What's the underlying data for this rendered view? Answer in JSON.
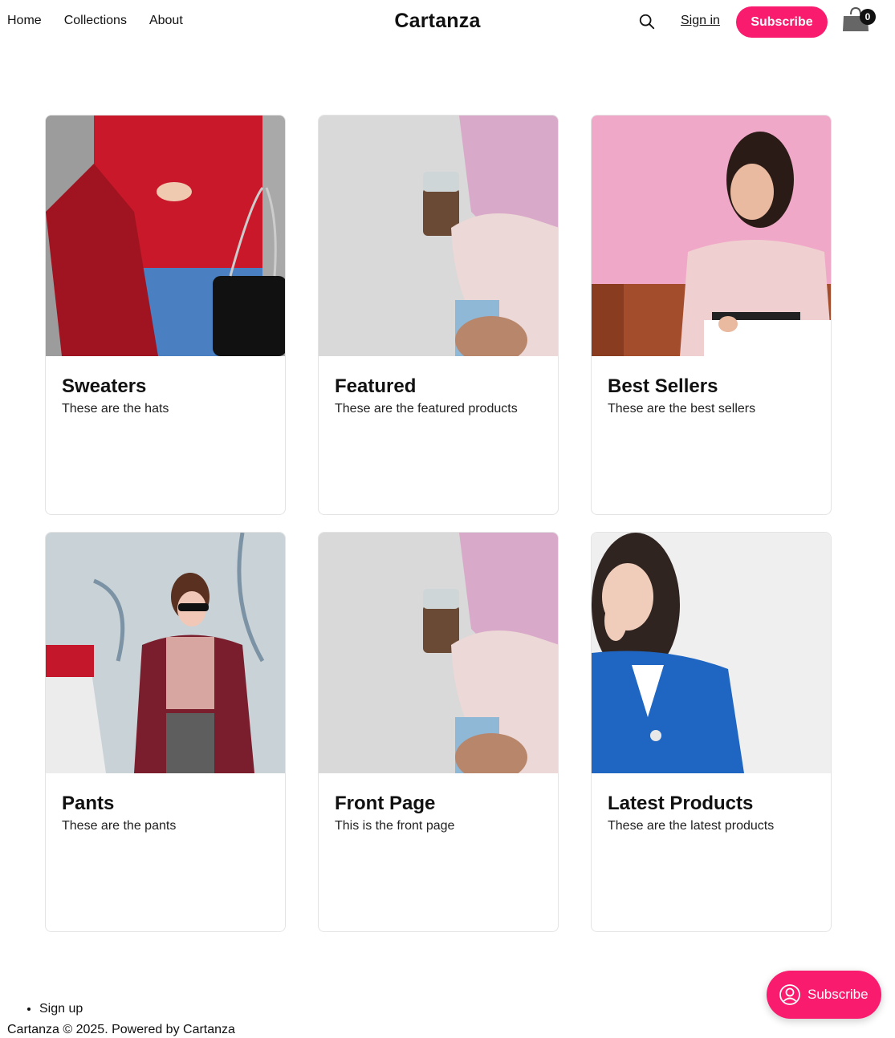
{
  "header": {
    "nav": [
      "Home",
      "Collections",
      "About"
    ],
    "brand": "Cartanza",
    "signin": "Sign in",
    "subscribe": "Subscribe",
    "cart_count": "0"
  },
  "collections": [
    {
      "title": "Sweaters",
      "description": "These are the hats"
    },
    {
      "title": "Featured",
      "description": "These are the featured products"
    },
    {
      "title": "Best Sellers",
      "description": "These are the best sellers"
    },
    {
      "title": "Pants",
      "description": "These are the pants"
    },
    {
      "title": "Front Page",
      "description": "This is the front page"
    },
    {
      "title": "Latest Products",
      "description": "These are the latest products"
    }
  ],
  "footer": {
    "links": [
      "Sign up"
    ],
    "copyright": "Cartanza © 2025. Powered by Cartanza"
  },
  "floating": {
    "label": "Subscribe"
  },
  "colors": {
    "accent": "#f91c6e"
  }
}
